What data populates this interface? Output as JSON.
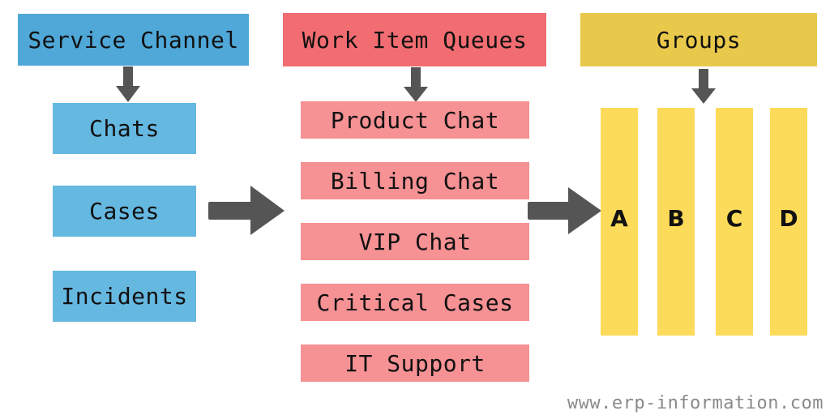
{
  "columns": {
    "service_channel": {
      "title": "Service Channel",
      "items": [
        "Chats",
        "Cases",
        "Incidents"
      ],
      "color_header": "#4fa8d8",
      "color_item": "#65b8e0"
    },
    "work_item_queues": {
      "title": "Work Item Queues",
      "items": [
        "Product Chat",
        "Billing Chat",
        "VIP Chat",
        "Critical Cases",
        "IT Support"
      ],
      "color_header": "#f26d72",
      "color_item": "#f69194"
    },
    "groups": {
      "title": "Groups",
      "items": [
        "A",
        "B",
        "C",
        "D"
      ],
      "color_header": "#e8c94b",
      "color_item": "#fddb5a"
    }
  },
  "arrows": {
    "color": "#555555",
    "icon": "arrow"
  },
  "watermark": "www.erp-information.com"
}
